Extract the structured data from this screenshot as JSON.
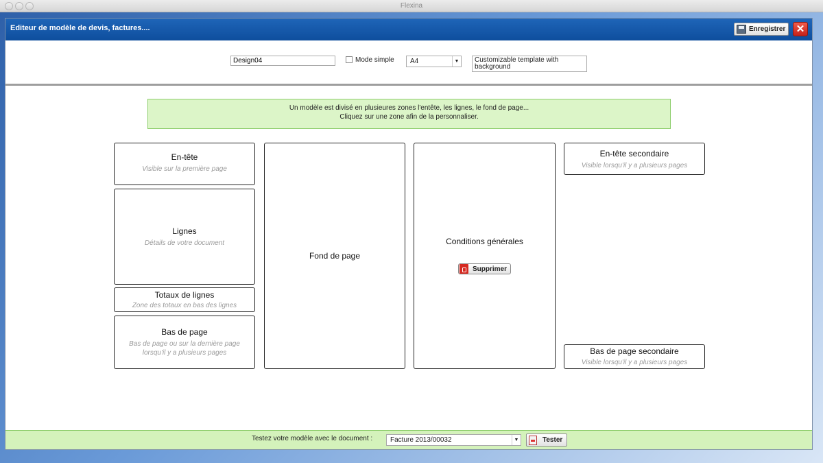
{
  "window": {
    "title": "Flexina"
  },
  "dialog": {
    "title": "Editeur de modèle de devis, factures....",
    "save_label": "Enregistrer",
    "close_glyph": "✕"
  },
  "toolbar": {
    "design_name": "Design04",
    "mode_simple_label": "Mode simple",
    "mode_simple_checked": false,
    "page_format": "A4",
    "description": "Customizable template with background"
  },
  "info": {
    "line1": "Un modèle est divisé en plusieures zones l'entête, les lignes, le fond de page...",
    "line2": "Cliquez sur une zone afin de la personnaliser."
  },
  "zones": {
    "entete": {
      "title": "En-tête",
      "subtitle": "Visible sur la première page"
    },
    "lignes": {
      "title": "Lignes",
      "subtitle": "Détails de votre document"
    },
    "totaux": {
      "title": "Totaux de lignes",
      "subtitle": "Zone des totaux en bas des lignes"
    },
    "bas": {
      "title": "Bas de page",
      "subtitle_line1": "Bas de page ou sur la dernière page",
      "subtitle_line2": "lorsqu'il y a plusieurs pages"
    },
    "fond": {
      "title": "Fond de page"
    },
    "conditions": {
      "title": "Conditions générales",
      "delete_label": "Supprimer"
    },
    "entete_secondaire": {
      "title": "En-tête secondaire",
      "subtitle": "Visible lorsqu'il y a plusieurs pages"
    },
    "bas_secondaire": {
      "title": "Bas de page secondaire",
      "subtitle": "Visible lorsqu'il y a plusieurs pages"
    }
  },
  "footer": {
    "test_label": "Testez votre modèle avec le document :",
    "document": "Facture 2013/00032",
    "test_button": "Tester"
  }
}
